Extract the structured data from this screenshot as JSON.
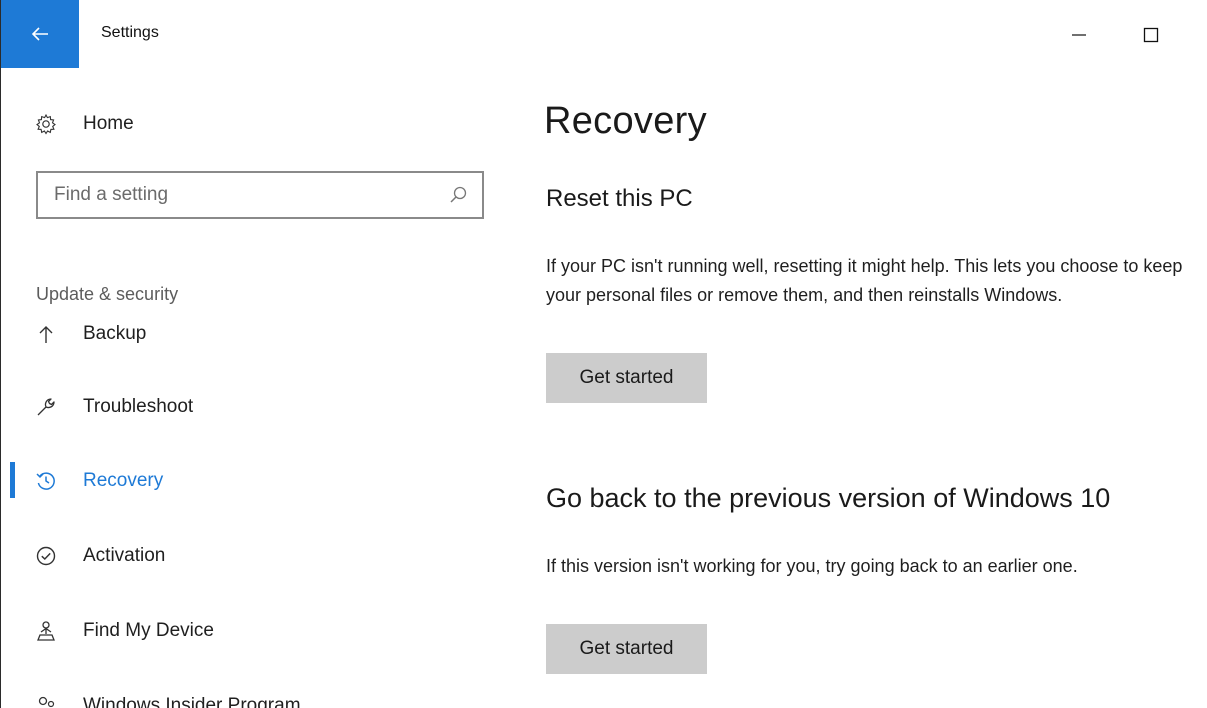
{
  "window": {
    "title": "Settings"
  },
  "sidebar": {
    "home_label": "Home",
    "search": {
      "placeholder": "Find a setting",
      "value": ""
    },
    "section_label": "Update & security",
    "items": [
      {
        "label": "Backup",
        "icon": "arrow-up-icon"
      },
      {
        "label": "Troubleshoot",
        "icon": "wrench-icon"
      },
      {
        "label": "Recovery",
        "icon": "recovery-icon",
        "active": true
      },
      {
        "label": "Activation",
        "icon": "checkmark-circle-icon"
      },
      {
        "label": "Find My Device",
        "icon": "person-location-icon"
      },
      {
        "label": "Windows Insider Program",
        "icon": "insider-people-icon"
      }
    ]
  },
  "main": {
    "title": "Recovery",
    "reset": {
      "heading": "Reset this PC",
      "description": "If your PC isn't running well, resetting it might help. This lets you choose to keep your personal files or remove them, and then reinstalls Windows.",
      "button": "Get started"
    },
    "goback": {
      "heading": "Go back to the previous version of Windows 10",
      "description": "If this version isn't working for you, try going back to an earlier one.",
      "button": "Get started"
    }
  },
  "colors": {
    "accent": "#1e7ad6",
    "button_bg": "#cccccc"
  }
}
